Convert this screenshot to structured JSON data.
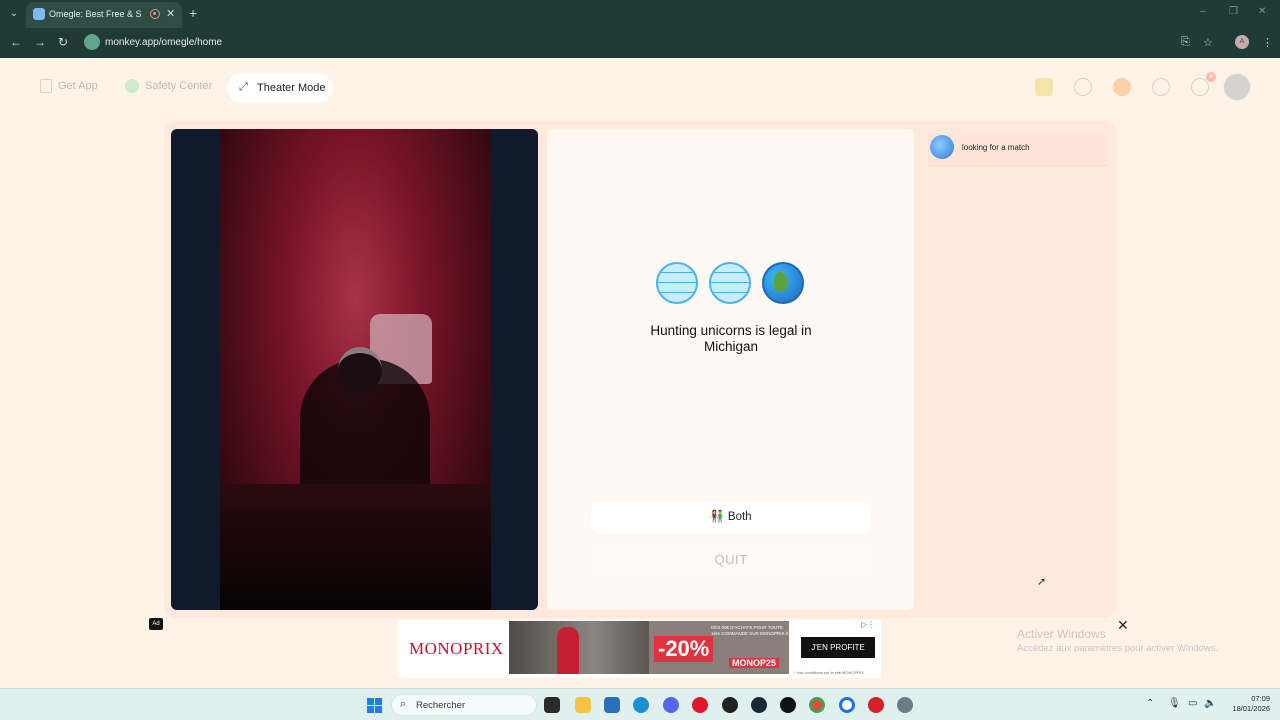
{
  "browser": {
    "tab_title": "Omegle: Best Free & Safe V",
    "url": "monkey.app/omegle/home",
    "profile_initial": "A",
    "window_controls": [
      "–",
      "❐",
      "✕"
    ]
  },
  "nav": {
    "get_app": "Get App",
    "safety_center": "Safety Center",
    "theater_mode": "Theater Mode",
    "notification_count": "4"
  },
  "match": {
    "fact": "Hunting unicorns is legal in Michigan",
    "gender_button": "👫 Both",
    "quit_button": "QUIT"
  },
  "chat": {
    "status": "looking for a match"
  },
  "ad": {
    "tag": "Ad",
    "brand": "MONOPRIX",
    "discount": "-20%",
    "small_text": "DÈS 60€ D'ACHATS POUR TOUTE 1ère COMMANDE SUR MONOPRIX.fr",
    "code": "MONOP25",
    "cta": "J'EN PROFITE",
    "fine_print": "* Voir conditions sur le site MONOPRIX"
  },
  "windows": {
    "activate_title": "Activer Windows",
    "activate_subtitle": "Accédez aux paramètres pour activer Windows.",
    "search_label": "Rechercher",
    "time": "07:09",
    "date": "18/01/2026"
  },
  "colors": {
    "page_bg": "#fff3e8",
    "panel_bg": "#ffe9dc",
    "chrome_bg": "#203a35",
    "taskbar_bg": "#dff0ef"
  }
}
